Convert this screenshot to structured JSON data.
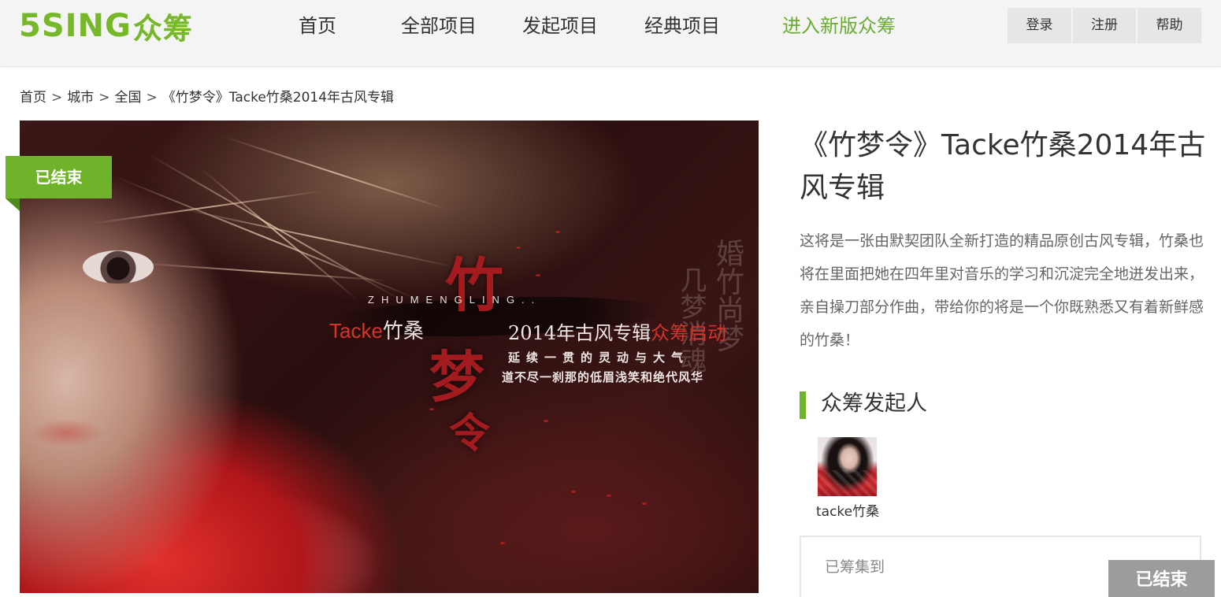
{
  "header": {
    "logo_text": "5SING",
    "logo_cn": "众筹",
    "nav": {
      "home": "首页",
      "all_projects": "全部项目",
      "start_project": "发起项目",
      "classic_projects": "经典项目",
      "new_version": "进入新版众筹"
    },
    "auth": {
      "login": "登录",
      "register": "注册",
      "help": "帮助"
    }
  },
  "breadcrumb": {
    "items": [
      "首页",
      "城市",
      "全国",
      "《竹梦令》Tacke竹桑2014年古风专辑"
    ],
    "separator": ">"
  },
  "poster": {
    "status_badge": "已结束",
    "en_title": "ZHUMENGLING..",
    "artist_plain": "Tacke",
    "artist_cn": "竹桑",
    "album_plain": "2014年古风专辑",
    "album_red": "众筹启动",
    "tagline_1": "延续一贯的灵动与大气",
    "tagline_2": "道不尽一刹那的低眉浅笑和绝代风华",
    "calligraphy": [
      "竹",
      "梦",
      "令"
    ],
    "faint_calligraphy_1": "婚竹尚梦",
    "faint_calligraphy_2": "几梦消魂"
  },
  "project": {
    "title": "《竹梦令》Tacke竹桑2014年古风专辑",
    "description": "这将是一张由默契团队全新打造的精品原创古风专辑，竹桑也将在里面把她在四年里对音乐的学习和沉淀完全地迸发出来，亲自操刀部分作曲，带给你的将是一个你既熟悉又有着新鲜感的竹桑！"
  },
  "initiator": {
    "section_title": "众筹发起人",
    "name": "tacke竹桑"
  },
  "funding": {
    "raised_label": "已筹集到",
    "status_button": "已结束"
  },
  "colors": {
    "brand_green": "#6fb32a",
    "nav_green": "#6aac2f",
    "ended_gray": "#9c9c9c",
    "header_bg": "#f4f4f4"
  }
}
